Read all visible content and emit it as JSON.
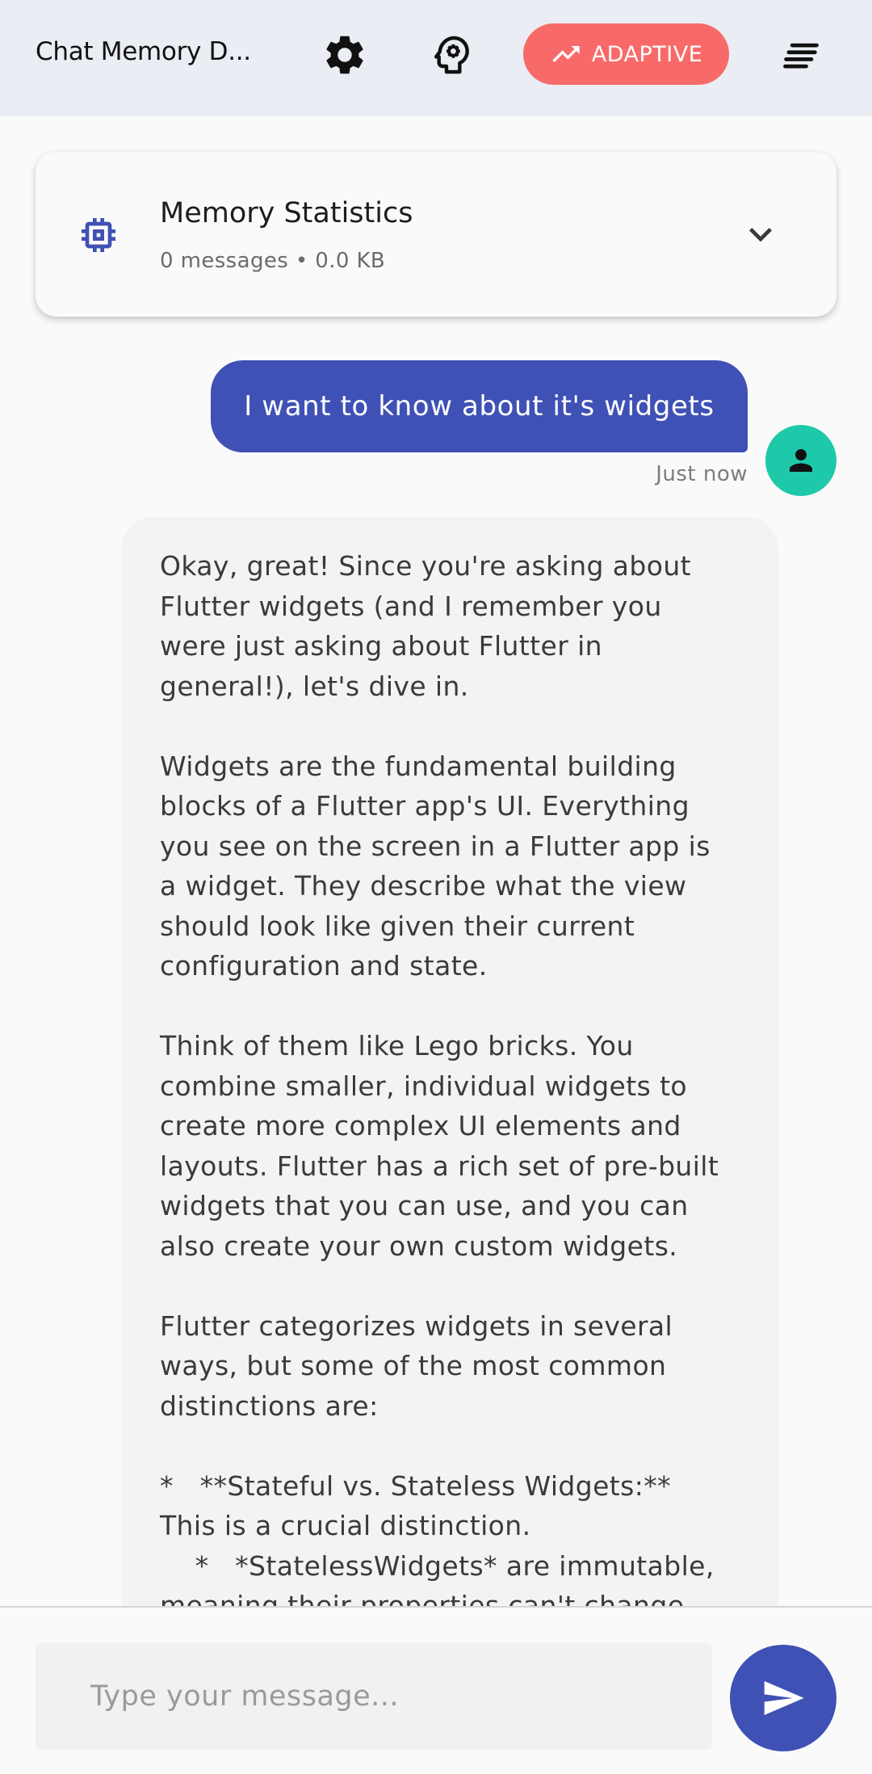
{
  "appbar": {
    "title": "Chat Memory D...",
    "adaptive_label": "ADAPTIVE",
    "icons": [
      "gear-icon",
      "psychology-icon",
      "trending-up-icon",
      "sort-menu-icon"
    ]
  },
  "memory_stats": {
    "title": "Memory Statistics",
    "subtitle": "0 messages • 0.0 KB",
    "icon": "memory-chip-icon"
  },
  "messages": {
    "user_text": "I want to know about it's widgets",
    "user_time": "Just now",
    "ai_text": "Okay, great! Since you're asking about\nFlutter widgets (and I remember you\nwere just asking about Flutter in\ngeneral!), let's dive in.\n\nWidgets are the fundamental building\nblocks of a Flutter app's UI. Everything\nyou see on the screen in a Flutter app is\na widget. They describe what the view\nshould look like given their current\nconfiguration and state.\n\nThink of them like Lego bricks. You\ncombine smaller, individual widgets to\ncreate more complex UI elements and\nlayouts. Flutter has a rich set of pre-built\nwidgets that you can use, and you can\nalso create your own custom widgets.\n\nFlutter categorizes widgets in several\nways, but some of the most common\ndistinctions are:\n\n*   **Stateful vs. Stateless Widgets:**\nThis is a crucial distinction.\n    *   *StatelessWidgets* are immutable,\nmeaning their properties can't change"
  },
  "composer": {
    "placeholder": "Type your message...",
    "value": ""
  },
  "colors": {
    "primary": "#3f51b5",
    "adaptive": "#f86a6a",
    "avatar": "#1dc9a8",
    "appbar_bg": "#eaedf3"
  }
}
